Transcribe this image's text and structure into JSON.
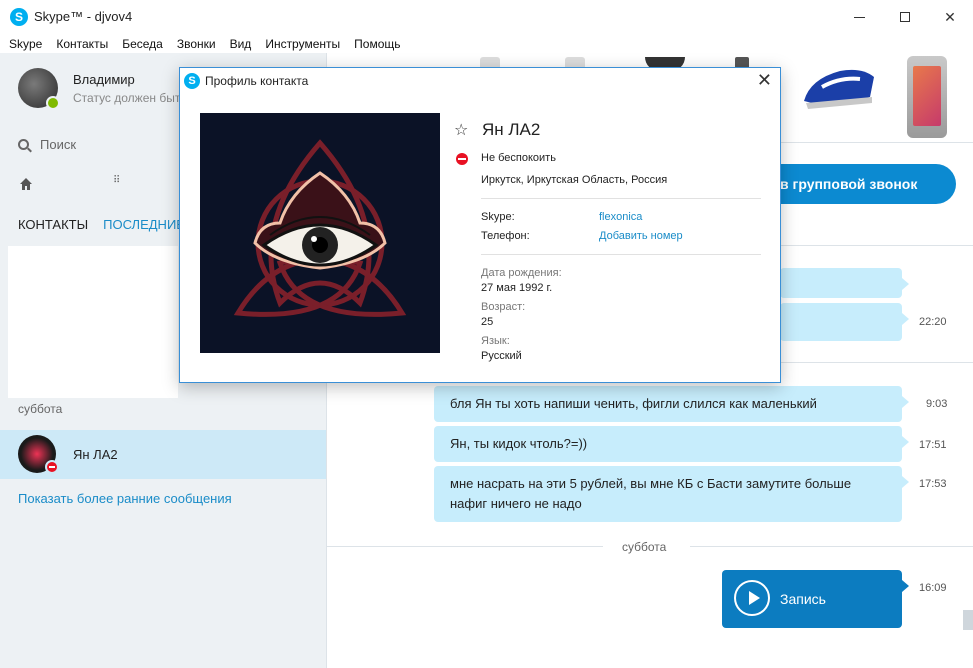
{
  "window": {
    "title": "Skype™ - djvov4",
    "app_icon": "skype-icon"
  },
  "menu": [
    "Skype",
    "Контакты",
    "Беседа",
    "Звонки",
    "Вид",
    "Инструменты",
    "Помощь"
  ],
  "me": {
    "name": "Владимир",
    "status_text": "Статус должен быт"
  },
  "search": {
    "label": "Поиск"
  },
  "tabs": {
    "contacts": "КОНТАКТЫ",
    "recent": "ПОСЛЕДНИЕ"
  },
  "recent": {
    "day_label": "суббота",
    "contact_name": "Ян ЛА2",
    "show_earlier": "Показать более ранние сообщения"
  },
  "conversation": {
    "group_call": "в групповой звонок",
    "messages": [
      {
        "text": "",
        "time": ""
      },
      {
        "text": "",
        "time": "22:20"
      },
      {
        "text": "бля Ян ты хоть напиши ченить, фигли слился как маленький",
        "time": "9:03"
      },
      {
        "text": "Ян, ты кидок чтоль?=))",
        "time": "17:51"
      },
      {
        "text": "мне насрать на эти 5 рублей, вы мне КБ с Басти замутите больше нафиг ничего не надо",
        "time": "17:53"
      }
    ],
    "day_separator": "суббота",
    "voice": {
      "label": "Запись",
      "time": "16:09"
    }
  },
  "dialog": {
    "title": "Профиль контакта",
    "name": "Ян ЛА2",
    "status": "Не беспокоить",
    "location": "Иркутск, Иркутская Область, Россия",
    "skype_label": "Skype:",
    "skype_value": "flexonica",
    "phone_label": "Телефон:",
    "phone_value": "Добавить номер",
    "birthday_label": "Дата рождения:",
    "birthday_value": "27 мая 1992 г.",
    "age_label": "Возраст:",
    "age_value": "25",
    "lang_label": "Язык:",
    "lang_value": "Русский"
  },
  "colors": {
    "accent": "#1a8cc8",
    "bubble": "#c7edfc",
    "dnd": "#e81123",
    "online": "#7fba00",
    "call_button": "#0c8ad1"
  }
}
